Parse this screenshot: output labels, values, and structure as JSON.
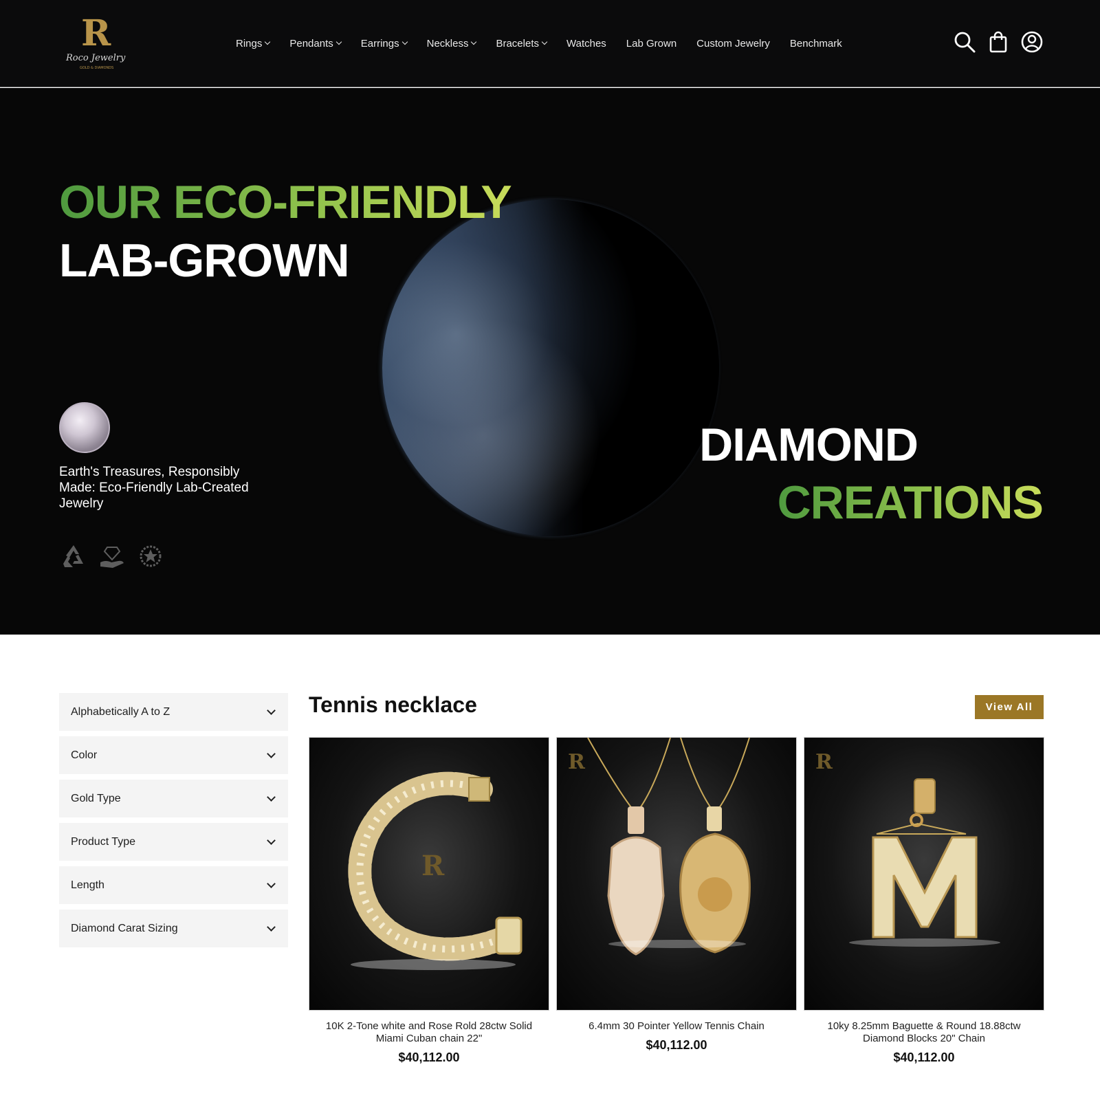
{
  "header": {
    "logo_text": "Roco Jewelry",
    "nav": [
      {
        "label": "Rings",
        "has_dropdown": true
      },
      {
        "label": "Pendants",
        "has_dropdown": true
      },
      {
        "label": "Earrings",
        "has_dropdown": true
      },
      {
        "label": "Neckless",
        "has_dropdown": true
      },
      {
        "label": "Bracelets",
        "has_dropdown": true
      },
      {
        "label": "Watches",
        "has_dropdown": false
      },
      {
        "label": "Lab Grown",
        "has_dropdown": false
      },
      {
        "label": "Custom Jewelry",
        "has_dropdown": false
      },
      {
        "label": "Benchmark",
        "has_dropdown": false
      }
    ],
    "icons": [
      "search-icon",
      "shopping-bag-icon",
      "user-account-icon"
    ]
  },
  "hero": {
    "line1": "OUR ECO-FRIENDLY",
    "line2": "LAB-GROWN",
    "line3": "DIAMOND",
    "line4": "CREATIONS",
    "tagline": "Earth's Treasures, Responsibly Made: Eco-Friendly Lab-Created Jewelry",
    "badges": [
      "recycle-icon",
      "hand-diamond-icon",
      "star-laurel-icon"
    ]
  },
  "filters": [
    {
      "label": "Alphabetically A to Z"
    },
    {
      "label": "Color"
    },
    {
      "label": "Gold Type"
    },
    {
      "label": "Product Type"
    },
    {
      "label": "Length"
    },
    {
      "label": "Diamond Carat Sizing"
    }
  ],
  "section": {
    "title": "Tennis necklace",
    "view_all_label": "View All"
  },
  "products": [
    {
      "name": "10K 2-Tone white and Rose Rold 28ctw Solid Miami Cuban chain 22\"",
      "price": "$40,112.00",
      "image": "cuban-chain-bracelet"
    },
    {
      "name": "6.4mm 30 Pointer Yellow Tennis Chain",
      "price": "$40,112.00",
      "image": "hamsa-and-lion-pendants"
    },
    {
      "name": "10ky 8.25mm Baguette & Round 18.88ctw Diamond Blocks 20\" Chain",
      "price": "$40,112.00",
      "image": "letter-m-pendant"
    }
  ],
  "colors": {
    "header_bg": "#0b0b0c",
    "hero_bg": "#070707",
    "eco_green_start": "#4f9a3f",
    "eco_green_end": "#c8dc5a",
    "gold_accent": "#9b7726"
  }
}
